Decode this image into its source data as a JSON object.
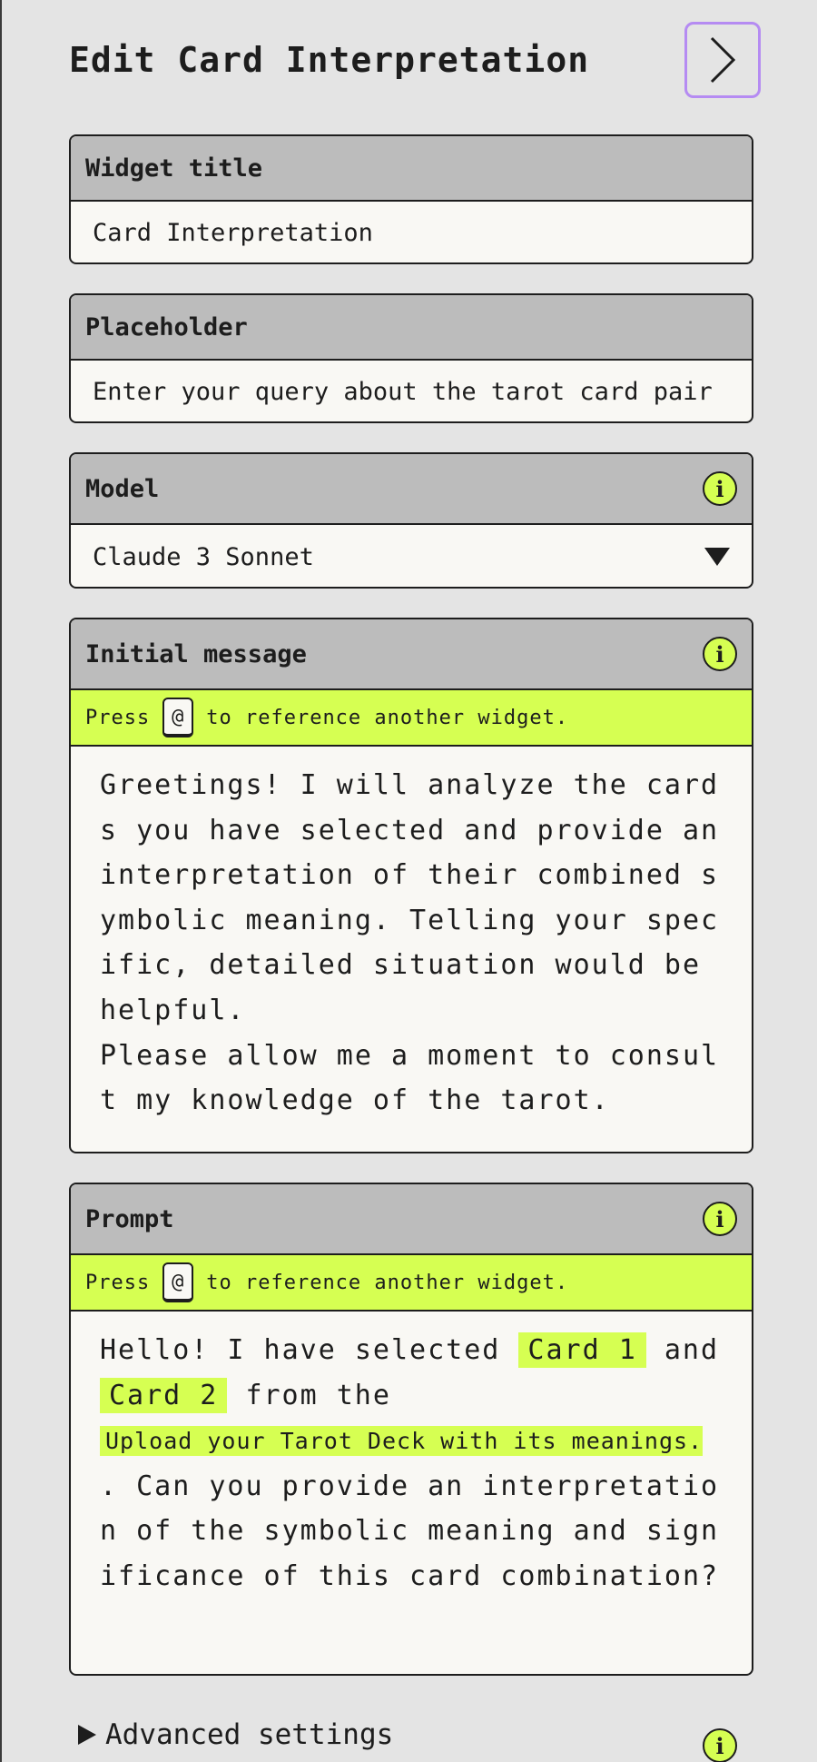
{
  "header": {
    "title": "Edit Card Interpretation"
  },
  "widget_title": {
    "label": "Widget title",
    "value": "Card Interpretation"
  },
  "placeholder": {
    "label": "Placeholder",
    "value": "Enter your query about the tarot card pair"
  },
  "model": {
    "label": "Model",
    "selected": "Claude 3 Sonnet"
  },
  "hint": {
    "press": "Press",
    "key": "@",
    "suffix": "to reference another widget."
  },
  "initial_message": {
    "label": "Initial message",
    "paragraph1": "Greetings! I will analyze the cards you have selected and provide an interpretation of their combined symbolic meaning. Telling your specific, detailed situation would be helpful.",
    "paragraph2": "Please allow me a moment to consult my knowledge of the tarot."
  },
  "prompt": {
    "label": "Prompt",
    "t1": "Hello! I have selected",
    "chip1": "Card 1",
    "t2": "and",
    "chip2": "Card 2",
    "t3": "from the",
    "chip3": "Upload your Tarot Deck with its meanings.",
    "t4": ". Can you provide an interpretation of the symbolic meaning and significance of this card combination?"
  },
  "advanced": {
    "label": "Advanced settings"
  },
  "colors": {
    "accent": "#d6ff52",
    "nav_border": "#b58bf2",
    "header_bg": "#bcbcbc"
  }
}
